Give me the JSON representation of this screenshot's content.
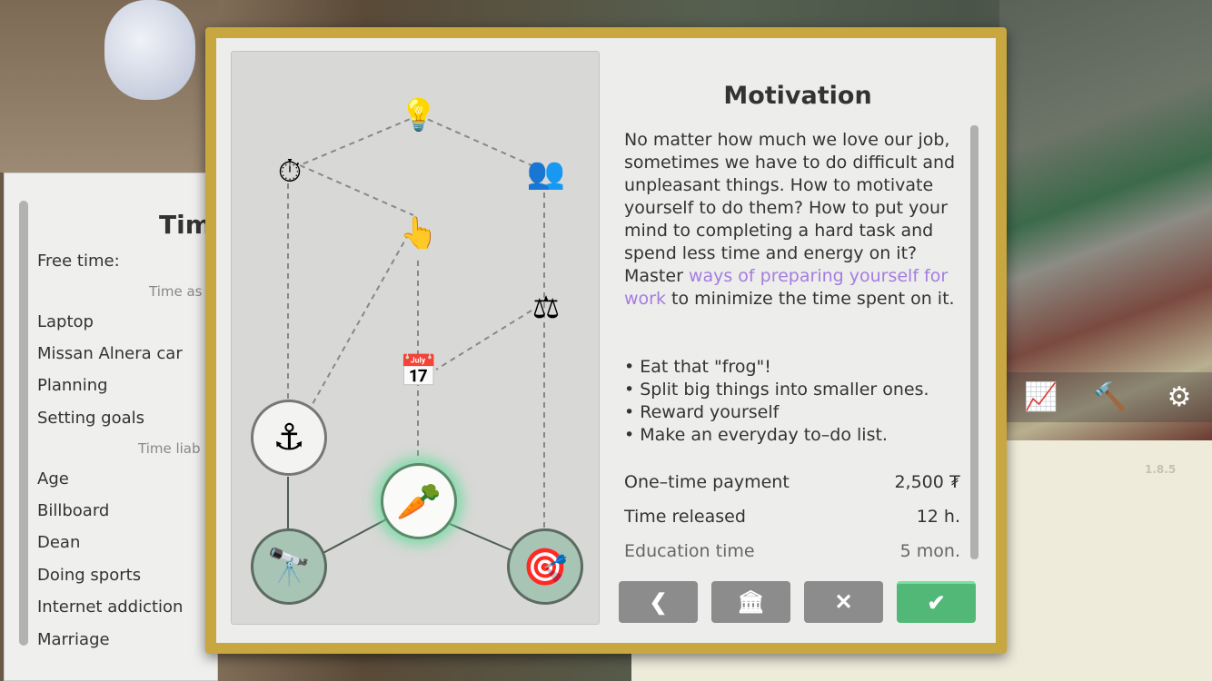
{
  "left_panel": {
    "title": "Tim",
    "free_time_label": "Free time:",
    "assets_header": "Time as",
    "asset_items": [
      "Laptop",
      "Missan Alnera car",
      "Planning",
      "Setting goals"
    ],
    "liabilities_header": "Time liab",
    "liability_items": [
      "Age",
      "Billboard",
      "Dean",
      "Doing sports",
      "Internet addiction",
      "Marriage"
    ]
  },
  "dialog": {
    "title": "Motivation",
    "description_before_link": "No matter how much we love our job, sometimes we have to do difficult and unpleasant things. How to motivate yourself to do them? How to put your mind to completing a hard task and spend less time and energy on it? Master ",
    "link": "ways of preparing yourself for work",
    "description_after_link": " to minimize the time spent on it.",
    "bullets": [
      "• Eat that \"frog\"!",
      "• Split big things into smaller ones.",
      "• Reward yourself",
      "• Make an everyday to–do list."
    ],
    "stats": [
      {
        "label": "One–time payment",
        "value": "2,500 ₮"
      },
      {
        "label": "Time released",
        "value": "12 h."
      },
      {
        "label": "Education time",
        "value": "5 mon."
      }
    ],
    "buttons": {
      "back": "❮",
      "bank": "🏛",
      "close": "✕",
      "confirm": "✔"
    },
    "colors": {
      "confirm": "#52b878",
      "link": "#a47de0",
      "frame": "#c8a640"
    }
  },
  "diagram_nodes": {
    "lightbulb": "💡",
    "stopwatch": "⏱",
    "people": "👥",
    "finger": "👆",
    "scales": "⚖",
    "calendar": "📅",
    "anchor": "⚓",
    "carrot": "🥕",
    "binoculars": "🔭",
    "dartboard": "🎯"
  },
  "toolbar_icons": {
    "chart": "📈",
    "hammer": "🔨",
    "settings": "⚙"
  },
  "version": "1.8.5"
}
